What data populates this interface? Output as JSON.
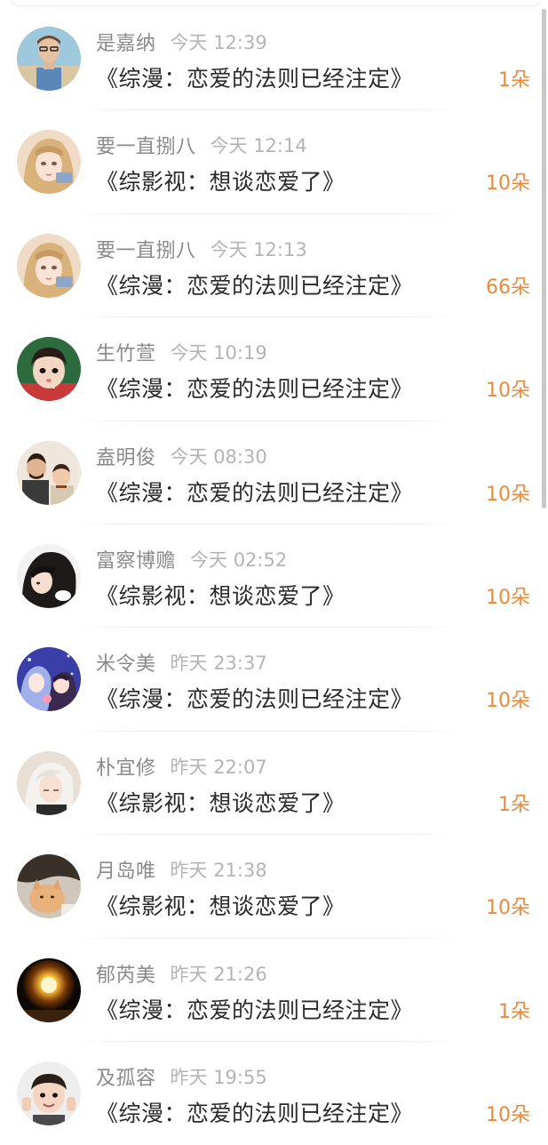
{
  "colors": {
    "name": "#8a8a8a",
    "time": "#b4b4b4",
    "title": "#2a2a2a",
    "flowers_accent": "#ec8a3a"
  },
  "rows": [
    {
      "name": "是嘉纳",
      "time": "今天 12:39",
      "title": "《综漫：恋爱的法则已经注定》",
      "flowers": "1朵",
      "avatar_icon": "avatar-photo-man-icon"
    },
    {
      "name": "要一直捌八",
      "time": "今天 12:14",
      "title": "《综影视：想谈恋爱了》",
      "flowers": "10朵",
      "avatar_icon": "avatar-anime-girl-icon"
    },
    {
      "name": "要一直捌八",
      "time": "今天 12:13",
      "title": "《综漫：恋爱的法则已经注定》",
      "flowers": "66朵",
      "avatar_icon": "avatar-anime-girl-icon"
    },
    {
      "name": "生竹萱",
      "time": "今天 10:19",
      "title": "《综漫：恋爱的法则已经注定》",
      "flowers": "10朵",
      "avatar_icon": "avatar-photo-child-icon"
    },
    {
      "name": "盍明俊",
      "time": "今天 08:30",
      "title": "《综漫：恋爱的法则已经注定》",
      "flowers": "10朵",
      "avatar_icon": "avatar-photo-family-icon"
    },
    {
      "name": "富察博赡",
      "time": "今天 02:52",
      "title": "《综影视：想谈恋爱了》",
      "flowers": "10朵",
      "avatar_icon": "avatar-photo-dark-hair-icon"
    },
    {
      "name": "米令美",
      "time": "昨天 23:37",
      "title": "《综漫：恋爱的法则已经注定》",
      "flowers": "10朵",
      "avatar_icon": "avatar-anime-couple-icon"
    },
    {
      "name": "朴宜修",
      "time": "昨天 22:07",
      "title": "《综影视：想谈恋爱了》",
      "flowers": "1朵",
      "avatar_icon": "avatar-anime-white-hair-icon"
    },
    {
      "name": "月岛唯",
      "time": "昨天 21:38",
      "title": "《综影视：想谈恋爱了》",
      "flowers": "10朵",
      "avatar_icon": "avatar-photo-cat-icon"
    },
    {
      "name": "郁芮美",
      "time": "昨天 21:26",
      "title": "《综漫：恋爱的法则已经注定》",
      "flowers": "1朵",
      "avatar_icon": "avatar-photo-light-bulb-icon"
    },
    {
      "name": "及孤容",
      "time": "昨天 19:55",
      "title": "《综漫：恋爱的法则已经注定》",
      "flowers": "10朵",
      "avatar_icon": "avatar-photo-boy-icon"
    }
  ]
}
